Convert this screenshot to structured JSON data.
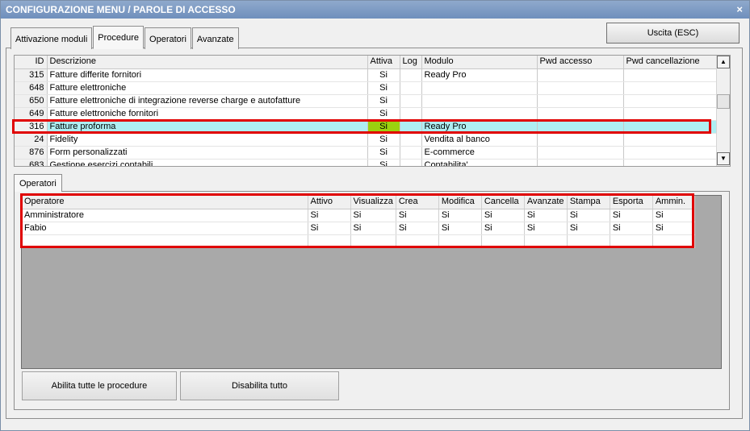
{
  "window": {
    "title": "CONFIGURAZIONE MENU / PAROLE DI ACCESSO",
    "close": "×"
  },
  "tabs": [
    {
      "label": "Attivazione moduli"
    },
    {
      "label": "Procedure"
    },
    {
      "label": "Operatori"
    },
    {
      "label": "Avanzate"
    }
  ],
  "active_tab": "Procedure",
  "exit_button": "Uscita (ESC)",
  "procedures": {
    "headers": [
      "ID",
      "Descrizione",
      "Attiva",
      "Log",
      "Modulo",
      "Pwd accesso",
      "Pwd cancellazione"
    ],
    "rows": [
      [
        "315",
        "Fatture differite fornitori",
        "Si",
        "",
        "Ready Pro",
        "",
        ""
      ],
      [
        "648",
        "Fatture elettroniche",
        "Si",
        "",
        "",
        "",
        ""
      ],
      [
        "650",
        "Fatture elettroniche di integrazione reverse charge e autofatture",
        "Si",
        "",
        "",
        "",
        ""
      ],
      [
        "649",
        "Fatture elettroniche fornitori",
        "Si",
        "",
        "",
        "",
        ""
      ],
      [
        "316",
        "Fatture proforma",
        "Si",
        "",
        "Ready Pro",
        "",
        ""
      ],
      [
        "24",
        "Fidelity",
        "Si",
        "",
        "Vendita al banco",
        "",
        ""
      ],
      [
        "876",
        "Form personalizzati",
        "Si",
        "",
        "E-commerce",
        "",
        ""
      ],
      [
        "683",
        "Gestione esercizi contabili",
        "Si",
        "",
        "Contabilita'",
        "",
        ""
      ]
    ],
    "selected_row_id": "316"
  },
  "operators_tab": "Operatori",
  "operators": {
    "headers": [
      "Operatore",
      "Attivo",
      "Visualizza",
      "Crea",
      "Modifica",
      "Cancella",
      "Avanzate",
      "Stampa",
      "Esporta",
      "Ammin."
    ],
    "rows": [
      [
        "Amministratore",
        "Si",
        "Si",
        "Si",
        "Si",
        "Si",
        "Si",
        "Si",
        "Si",
        "Si"
      ],
      [
        "Fabio",
        "Si",
        "Si",
        "Si",
        "Si",
        "Si",
        "Si",
        "Si",
        "Si",
        "Si"
      ],
      [
        "",
        "",
        "",
        "",
        "",
        "",
        "",
        "",
        "",
        ""
      ]
    ]
  },
  "buttons": {
    "enable_all": "Abilita tutte le procedure",
    "disable_all": "Disabilita tutto"
  },
  "colors": {
    "selected_row": "#aeeef2",
    "active_cell": "#9bd10f",
    "highlight_border": "#e00000"
  }
}
